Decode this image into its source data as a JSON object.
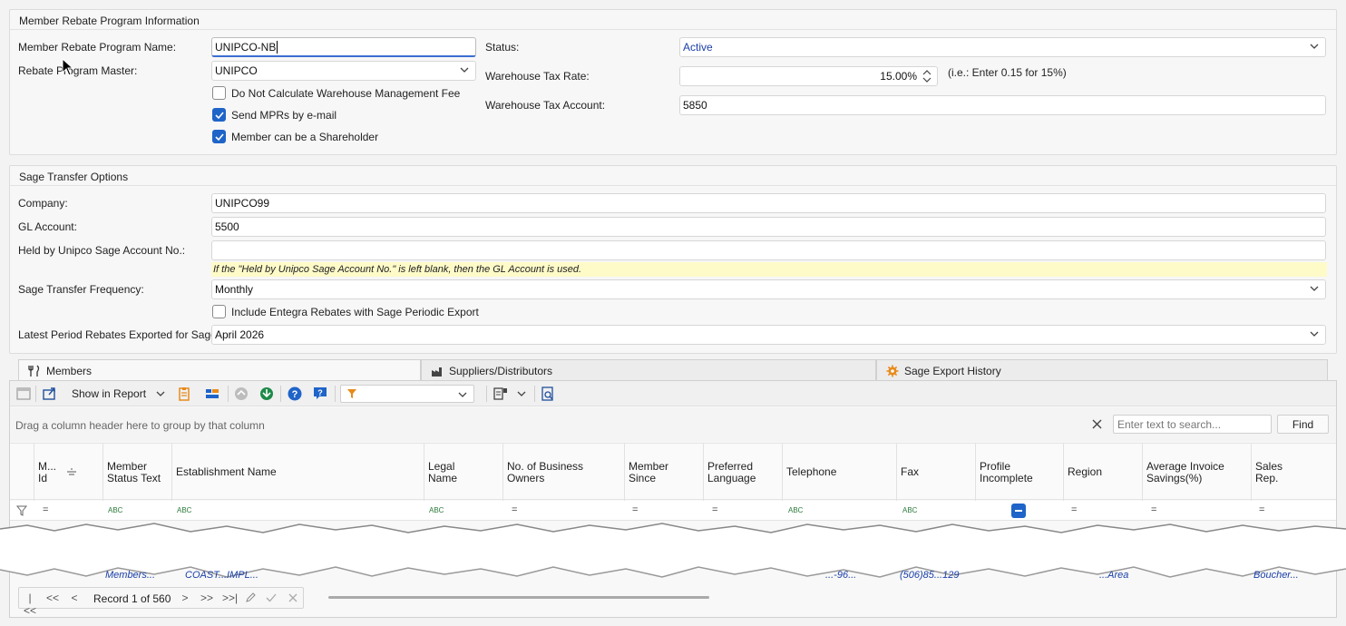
{
  "rebate_group": {
    "title": "Member Rebate Program Information",
    "program_name_label": "Member Rebate Program Name:",
    "program_name_value": "UNIPCO-NB",
    "master_label": "Rebate Program Master:",
    "master_value": "UNIPCO",
    "chk_no_fee_label": "Do Not Calculate Warehouse Management Fee",
    "chk_no_fee": false,
    "chk_send_mpr_label": "Send MPRs by e-mail",
    "chk_send_mpr": true,
    "chk_shareholder_label": "Member can be a Shareholder",
    "chk_shareholder": true,
    "status_label": "Status:",
    "status_value": "Active",
    "tax_rate_label": "Warehouse Tax Rate:",
    "tax_rate_value": "15.00%",
    "tax_rate_hint": "(i.e.: Enter 0.15 for 15%)",
    "tax_account_label": "Warehouse Tax Account:",
    "tax_account_value": "5850"
  },
  "sage_group": {
    "title": "Sage Transfer Options",
    "company_label": "Company:",
    "company_value": "UNIPCO99",
    "gl_label": "GL Account:",
    "gl_value": "5500",
    "held_label": "Held by Unipco Sage Account No.:",
    "held_value": "",
    "held_note": "If the \"Held by Unipco Sage Account No.\" is left blank, then the GL Account is used.",
    "frequency_label": "Sage Transfer Frequency:",
    "frequency_value": "Monthly",
    "include_entegra_label": "Include Entegra Rebates with Sage Periodic Export",
    "include_entegra": false,
    "latest_label": "Latest Period Rebates Exported for Sage:",
    "latest_value": "April 2026"
  },
  "tabs": [
    {
      "label": "Members",
      "active": true
    },
    {
      "label": "Suppliers/Distributors",
      "active": false
    },
    {
      "label": "Sage Export History",
      "active": false
    }
  ],
  "toolbar": {
    "show_in_report": "Show in Report"
  },
  "grid": {
    "group_hint": "Drag a column header here to group by that column",
    "search_placeholder": "Enter text to search...",
    "find_label": "Find",
    "columns": [
      {
        "label": "M... Id"
      },
      {
        "label": "Member Status Text"
      },
      {
        "label": "Establishment Name"
      },
      {
        "label": "Legal Name"
      },
      {
        "label": "No. of Business Owners"
      },
      {
        "label": "Member Since"
      },
      {
        "label": "Preferred Language"
      },
      {
        "label": "Telephone"
      },
      {
        "label": "Fax"
      },
      {
        "label": "Profile Incomplete"
      },
      {
        "label": "Region"
      },
      {
        "label": "Average Invoice Savings(%)"
      },
      {
        "label": "Sales Rep."
      }
    ],
    "partial_row_bottom": [
      "Members...",
      "COAST...IMPL...",
      "...-96...",
      "(506)85...129",
      "...Area",
      "Boucher..."
    ]
  },
  "navigator": {
    "record_text": "Record 1 of 560"
  },
  "colors": {
    "accent": "#1f64c8",
    "note_bg": "#fefbc8",
    "status_text": "#1a3fa8"
  }
}
